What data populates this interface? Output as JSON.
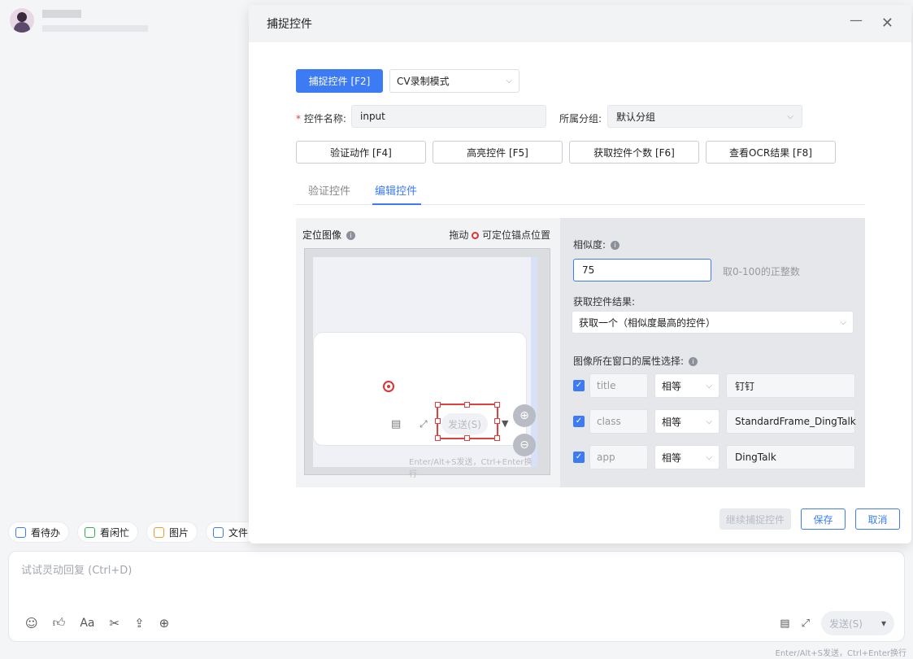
{
  "colors": {
    "accent": "#3c7bf4",
    "danger": "#e04040"
  },
  "background": {
    "quick_actions": [
      "看待办",
      "看闲忙",
      "图片",
      "文件"
    ],
    "composer": {
      "placeholder": "试试灵动回复 (Ctrl+D)",
      "send_label": "发送(S)",
      "hint": "Enter/Alt+S发送，Ctrl+Enter换行",
      "tool_icons": [
        "emoji-icon",
        "thumbs-up-icon",
        "font-icon",
        "scissors-icon",
        "folder-upload-icon",
        "plus-circle-icon"
      ]
    }
  },
  "dialog": {
    "title": "捕捉控件",
    "capture_button": "捕捉控件 [F2]",
    "mode_select": "CV录制模式",
    "name_label": "控件名称:",
    "name_value": "input",
    "group_label": "所属分组:",
    "group_value": "默认分组",
    "actions": [
      "验证动作 [F4]",
      "高亮控件 [F5]",
      "获取控件个数 [F6]",
      "查看OCR结果 [F8]"
    ],
    "tabs": [
      "验证控件",
      "编辑控件"
    ],
    "active_tab": "编辑控件",
    "locate_image": {
      "title": "定位图像",
      "hint_prefix": "拖动",
      "hint_suffix": "可定位锚点位置",
      "preview_send": "发送(S)",
      "preview_hint": "Enter/Alt+S发送，Ctrl+Enter换行"
    },
    "similarity": {
      "label": "相似度:",
      "value": "75",
      "hint": "取0-100的正整数"
    },
    "result": {
      "label": "获取控件结果:",
      "value": "获取一个（相似度最高的控件）"
    },
    "window_props": {
      "label": "图像所在窗口的属性选择:",
      "rows": [
        {
          "key": "title",
          "op": "相等",
          "value": "钉钉",
          "checked": true
        },
        {
          "key": "class",
          "op": "相等",
          "value": "StandardFrame_DingTalk",
          "checked": true
        },
        {
          "key": "app",
          "op": "相等",
          "value": "DingTalk",
          "checked": true
        }
      ]
    },
    "footer": {
      "continue": "继续捕捉控件",
      "save": "保存",
      "cancel": "取消"
    }
  }
}
